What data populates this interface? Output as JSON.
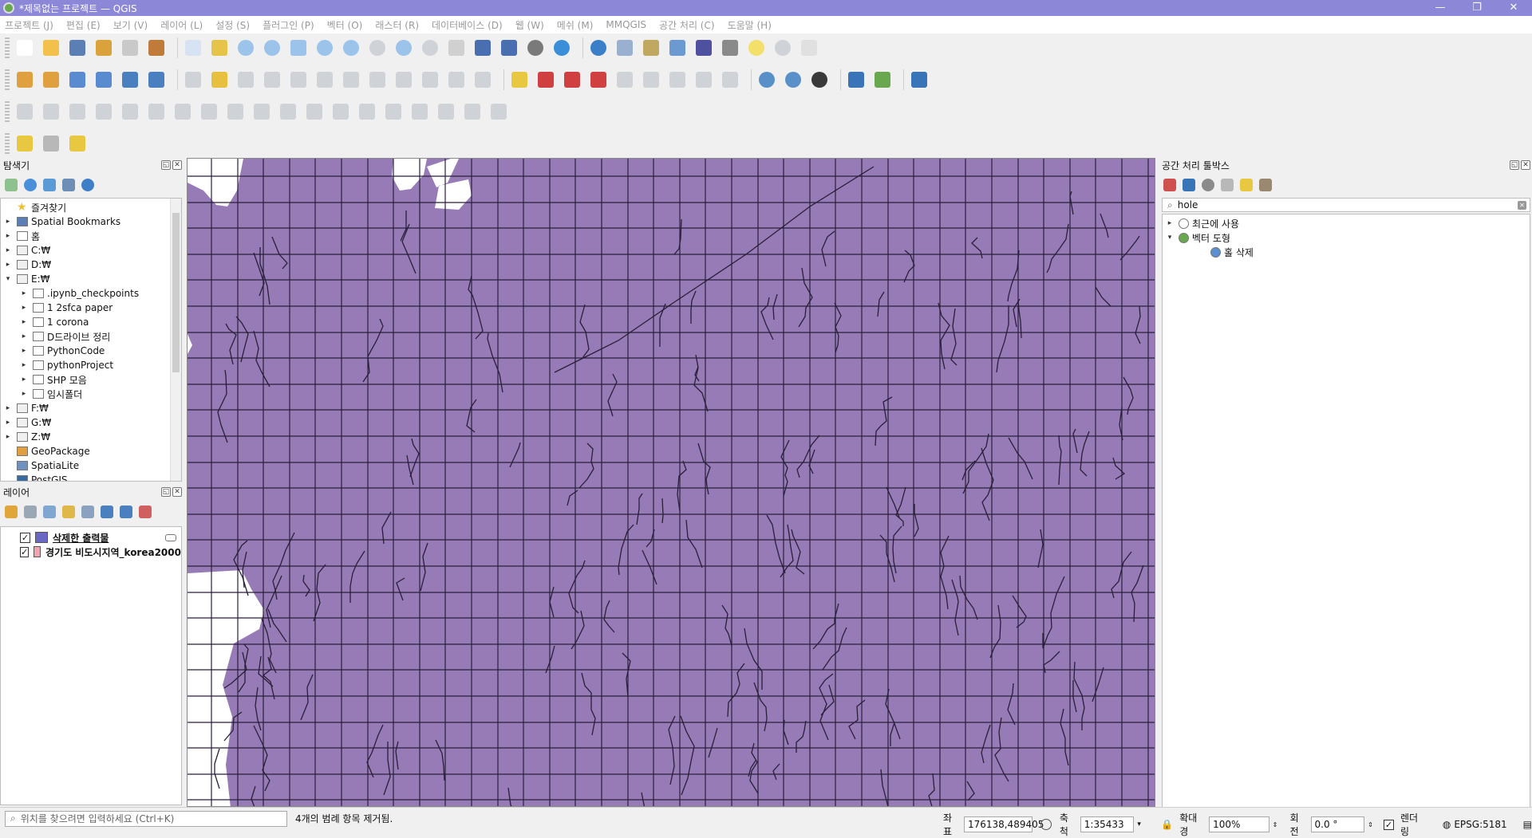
{
  "window": {
    "title": "*제목없는 프로젝트 — QGIS",
    "controls": [
      "—",
      "❐",
      "✕"
    ]
  },
  "menu": [
    "프로젝트 (J)",
    "편집 (E)",
    "보기 (V)",
    "레이어 (L)",
    "설정 (S)",
    "플러그인 (P)",
    "벡터 (O)",
    "래스터 (R)",
    "데이터베이스 (D)",
    "웹 (W)",
    "메쉬 (M)",
    "MMQGIS",
    "공간 처리 (C)",
    "도움말 (H)"
  ],
  "browser": {
    "title": "탐색기",
    "items": [
      {
        "label": "즐겨찾기",
        "arrow": "",
        "icon": "star-icon",
        "indent": 0
      },
      {
        "label": "Spatial Bookmarks",
        "arrow": "▸",
        "icon": "bookmark-icon",
        "indent": 0
      },
      {
        "label": "홈",
        "arrow": "▸",
        "icon": "home-icon",
        "indent": 0
      },
      {
        "label": "C:₩",
        "arrow": "▸",
        "icon": "drive-icon",
        "indent": 0
      },
      {
        "label": "D:₩",
        "arrow": "▸",
        "icon": "drive-icon",
        "indent": 0
      },
      {
        "label": "E:₩",
        "arrow": "▾",
        "icon": "drive-icon",
        "indent": 0
      },
      {
        "label": ".ipynb_checkpoints",
        "arrow": "▸",
        "icon": "folder-icon",
        "indent": 1
      },
      {
        "label": "1 2sfca paper",
        "arrow": "▸",
        "icon": "folder-icon",
        "indent": 1
      },
      {
        "label": "1 corona",
        "arrow": "▸",
        "icon": "folder-icon",
        "indent": 1
      },
      {
        "label": "D드라이브 정리",
        "arrow": "▸",
        "icon": "folder-icon",
        "indent": 1
      },
      {
        "label": "PythonCode",
        "arrow": "▸",
        "icon": "folder-icon",
        "indent": 1
      },
      {
        "label": "pythonProject",
        "arrow": "▸",
        "icon": "folder-icon",
        "indent": 1
      },
      {
        "label": "SHP 모음",
        "arrow": "▸",
        "icon": "folder-icon",
        "indent": 1
      },
      {
        "label": "임시폴더",
        "arrow": "▸",
        "icon": "folder-icon",
        "indent": 1
      },
      {
        "label": "F:₩",
        "arrow": "▸",
        "icon": "drive-icon",
        "indent": 0
      },
      {
        "label": "G:₩",
        "arrow": "▸",
        "icon": "drive-icon",
        "indent": 0
      },
      {
        "label": "Z:₩",
        "arrow": "▸",
        "icon": "drive-icon",
        "indent": 0
      },
      {
        "label": "GeoPackage",
        "arrow": "",
        "icon": "geopackage-icon",
        "indent": 0
      },
      {
        "label": "SpatiaLite",
        "arrow": "",
        "icon": "spatialite-icon",
        "indent": 0
      },
      {
        "label": "PostGIS",
        "arrow": "",
        "icon": "postgis-icon",
        "indent": 0
      }
    ]
  },
  "layers": {
    "title": "레이어",
    "items": [
      {
        "label": "삭제한 출력물",
        "checked": true,
        "color": "#6b68c4",
        "selected": true
      },
      {
        "label": "경기도 비도시지역_korea2000",
        "checked": true,
        "color": "#f2a3ad",
        "selected": false
      }
    ]
  },
  "processing": {
    "title": "공간 처리 툴박스",
    "search": "hole",
    "items": [
      {
        "label": "최근에 사용",
        "arrow": "▸",
        "icon": "clock-icon",
        "indent": 0
      },
      {
        "label": "벡터 도형",
        "arrow": "▾",
        "icon": "qgis-icon",
        "indent": 0
      },
      {
        "label": "홀 삭제",
        "arrow": "",
        "icon": "gear-icon",
        "indent": 1
      }
    ]
  },
  "map": {
    "fill": "#967bb6",
    "line": "#2a1f3a"
  },
  "status": {
    "locator_placeholder": "위치를 찾으려면 입력하세요 (Ctrl+K)",
    "message": "4개의 범례 항목 제거됨.",
    "coord_label": "좌표",
    "coord": "176138,489405",
    "scale_label": "축척",
    "scale": "1:35433",
    "magnifier_label": "확대경",
    "magnifier": "100%",
    "rotation_label": "회전",
    "rotation": "0.0 °",
    "render_label": "렌더링",
    "epsg": "EPSG:5181"
  }
}
